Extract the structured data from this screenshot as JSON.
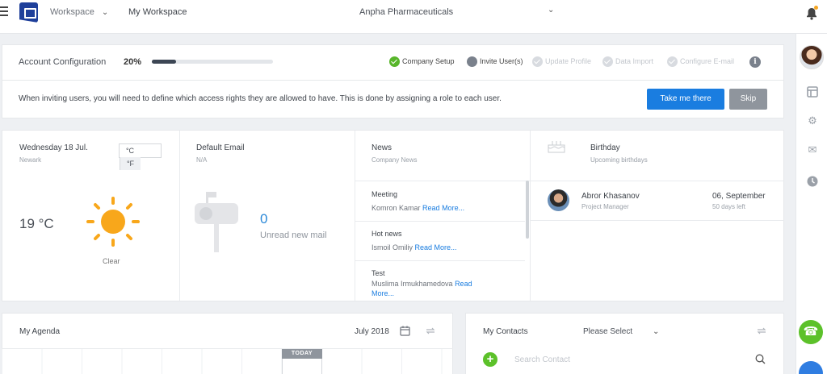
{
  "topbar": {
    "workspace_menu": "Workspace",
    "breadcrumb_current": "My Workspace",
    "company_select": "Anpha Pharmaceuticals",
    "chevron": "⌄"
  },
  "account_config": {
    "title": "Account Configuration",
    "progress_label": "20%",
    "progress_value": 0.2,
    "steps": [
      {
        "label": "Company Setup",
        "state": "done"
      },
      {
        "label": "Invite User(s)",
        "state": "current"
      },
      {
        "label": "Update Profile",
        "state": "pending"
      },
      {
        "label": "Data Import",
        "state": "pending"
      },
      {
        "label": "Configure E-mail",
        "state": "pending"
      }
    ],
    "info_glyph": "i"
  },
  "invite_banner": {
    "text": "When inviting users, you will need to define which access rights they are allowed to have. This is done by assigning a role to each user.",
    "primary_button": "Take me there",
    "secondary_button": "Skip"
  },
  "weather": {
    "date": "Wednesday 18 Jul.",
    "location": "Newark",
    "unit_c": "°C",
    "unit_f": "°F",
    "active_unit": "F",
    "temperature": "19 °C",
    "condition": "Clear",
    "icon": "sun-icon"
  },
  "email_widget": {
    "title": "Default Email",
    "account": "N/A",
    "count": "0",
    "count_label": "Unread new mail",
    "icon": "mailbox-icon"
  },
  "news_widget": {
    "title": "News",
    "subtitle": "Company News",
    "read_more": "Read More...",
    "items": [
      {
        "title": "Meeting",
        "author": "Komron Kamar"
      },
      {
        "title": "Hot news",
        "author": "Ismoil Omiliy"
      },
      {
        "title": "Test",
        "author": "Muslima Irmukhamedova"
      }
    ]
  },
  "birthday_widget": {
    "title": "Birthday",
    "subtitle": "Upcoming birthdays",
    "icon": "cake-icon",
    "person": {
      "name": "Abror Khasanov",
      "role": "Project Manager",
      "date": "06, September",
      "days_left": "50 days left"
    }
  },
  "agenda": {
    "title": "My Agenda",
    "month": "July 2018",
    "today_label": "TODAY"
  },
  "contacts": {
    "title": "My Contacts",
    "filter_value": "Please Select",
    "search_placeholder": "Search Contact"
  },
  "colors": {
    "primary": "#1a7de0",
    "success": "#5cc12a",
    "brand": "#1e3f9a",
    "muted": "#8f959d"
  }
}
